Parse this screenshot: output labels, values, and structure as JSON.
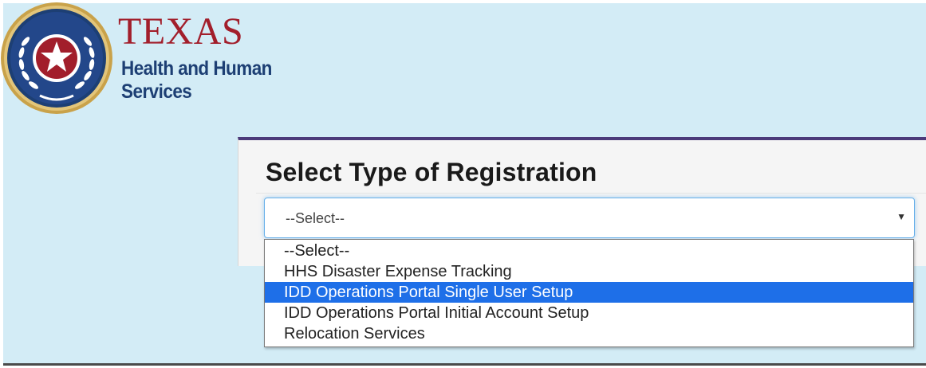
{
  "brand": {
    "title": "TEXAS",
    "subtitle_line1": "Health and Human",
    "subtitle_line2": "Services",
    "seal_icon": "texas-seal-icon",
    "colors": {
      "title": "#a21e2b",
      "subtitle": "#1d3f74"
    }
  },
  "registration": {
    "title": "Select Type of Registration",
    "selected_value": "--Select--",
    "options": [
      {
        "label": "--Select--",
        "highlighted": false
      },
      {
        "label": "HHS Disaster Expense Tracking",
        "highlighted": false
      },
      {
        "label": "IDD Operations Portal Single User Setup",
        "highlighted": true
      },
      {
        "label": "IDD Operations Portal Initial Account Setup",
        "highlighted": false
      },
      {
        "label": "Relocation Services",
        "highlighted": false
      }
    ],
    "arrow_icon": "caret-down-icon"
  },
  "colors": {
    "page_background": "#d3ecf6",
    "card_accent": "#4b3a7a",
    "highlight": "#1e6fe8"
  }
}
